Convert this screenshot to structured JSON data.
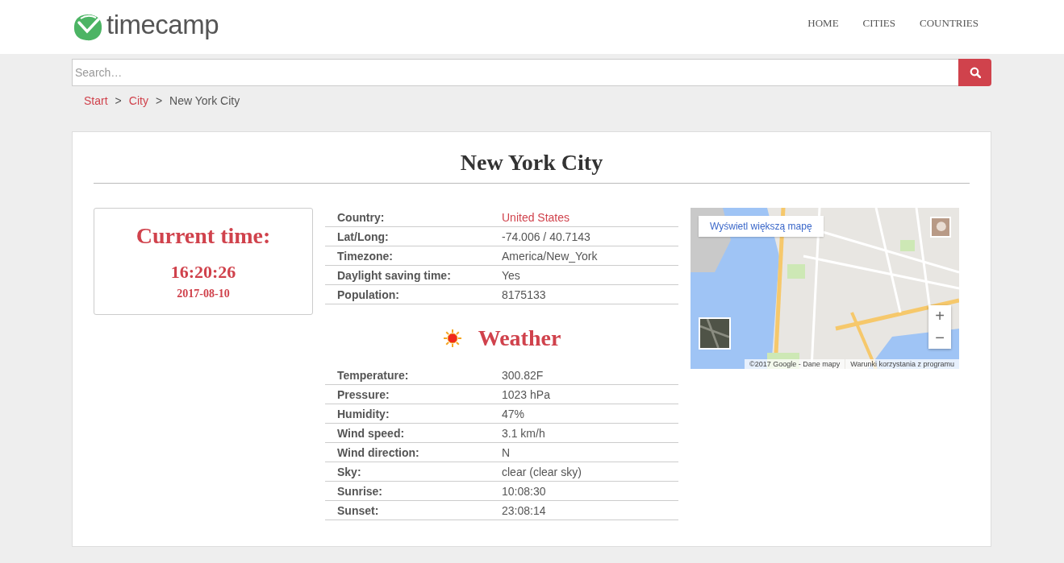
{
  "header": {
    "logo": "timecamp",
    "nav": [
      {
        "label": "HOME"
      },
      {
        "label": "CITIES"
      },
      {
        "label": "COUNTRIES"
      }
    ]
  },
  "search": {
    "placeholder": "Search…"
  },
  "breadcrumb": [
    {
      "label": "Start",
      "kind": "link"
    },
    {
      "label": "City",
      "kind": "link"
    },
    {
      "label": "New York City",
      "kind": "current"
    }
  ],
  "breadcrumb_separator": ">",
  "title": "New York City",
  "current_time": {
    "heading": "Current time:",
    "time": "16:20:26",
    "date": "2017-08-10"
  },
  "info": [
    {
      "label": "Country:",
      "value": "United States",
      "kind": "link"
    },
    {
      "label": "Lat/Long:",
      "value": "-74.006 / 40.7143",
      "kind": "text"
    },
    {
      "label": "Timezone:",
      "value": "America/New_York",
      "kind": "text"
    },
    {
      "label": "Daylight saving time:",
      "value": "Yes",
      "kind": "text"
    },
    {
      "label": "Population:",
      "value": "8175133",
      "kind": "text"
    }
  ],
  "weather": {
    "heading": "Weather",
    "rows": [
      {
        "label": "Temperature:",
        "value": "300.82F"
      },
      {
        "label": "Pressure:",
        "value": "1023 hPa"
      },
      {
        "label": "Humidity:",
        "value": "47%"
      },
      {
        "label": "Wind speed:",
        "value": "3.1 km/h"
      },
      {
        "label": "Wind direction:",
        "value": "N"
      },
      {
        "label": "Sky:",
        "value": "clear (clear sky)"
      },
      {
        "label": "Sunrise:",
        "value": "10:08:30"
      },
      {
        "label": "Sunset:",
        "value": "23:08:14"
      }
    ]
  },
  "map": {
    "kind": "picture",
    "larger_map_button": "Wyświetl większą mapę",
    "zoom_in": "+",
    "zoom_out": "−",
    "attribution": [
      "©2017 Google - Dane mapy",
      "Warunki korzystania z programu"
    ]
  }
}
